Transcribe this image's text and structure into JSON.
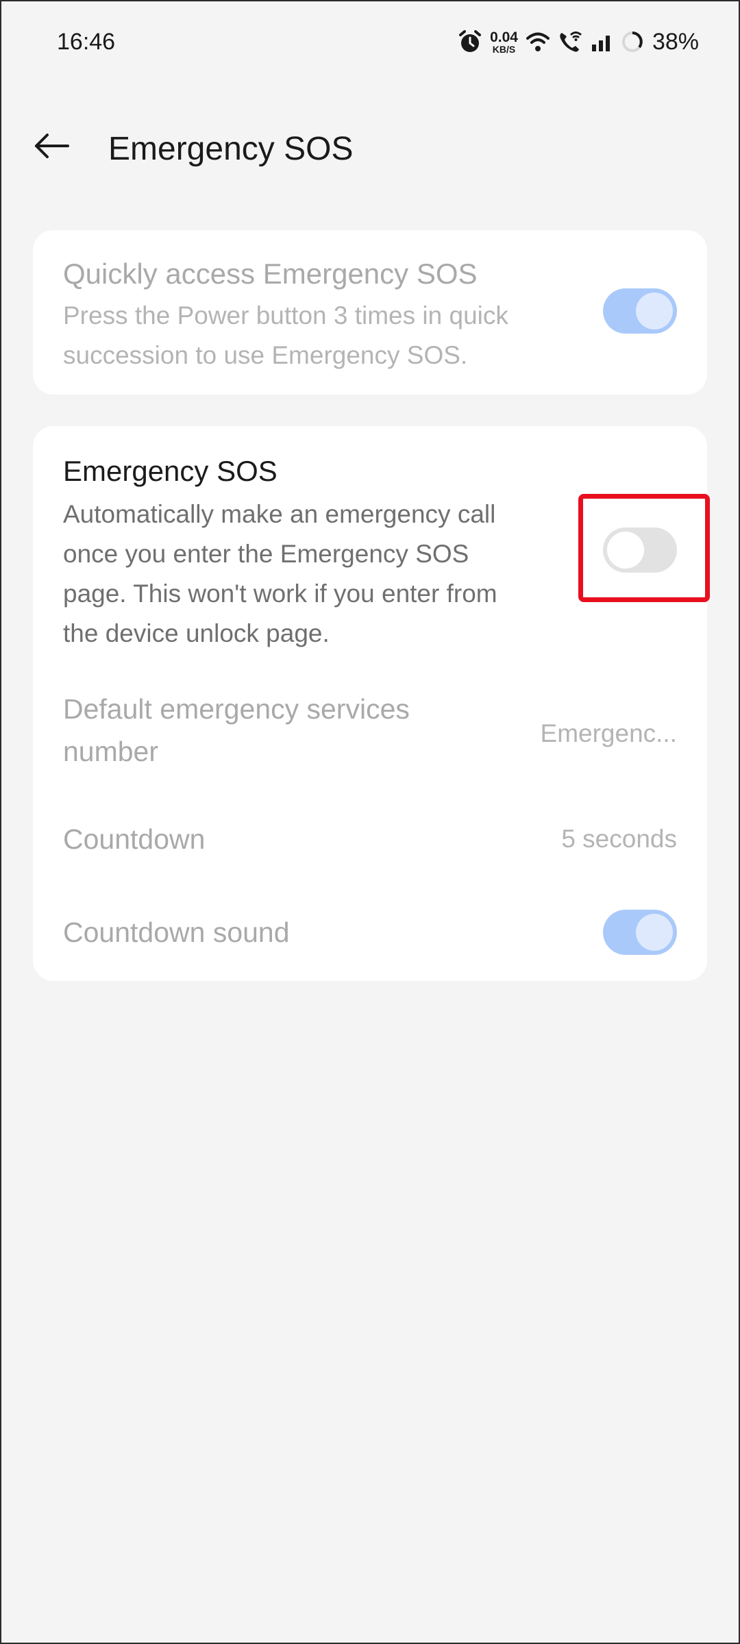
{
  "status_bar": {
    "time": "16:46",
    "net_speed_value": "0.04",
    "net_speed_unit": "KB/S",
    "battery_percent": "38%",
    "icons": [
      "alarm-icon",
      "wifi-icon",
      "wifi-calling-icon",
      "signal-icon",
      "battery-ring-icon"
    ]
  },
  "header": {
    "back_icon": "arrow-left-icon",
    "title": "Emergency SOS"
  },
  "quick_access": {
    "title": "Quickly access Emergency SOS",
    "description_line1": "Press the Power button 3 times in quick",
    "description_line2": "succession to use Emergency SOS.",
    "toggle_state": "on",
    "enabled": false
  },
  "emergency_sos": {
    "title": "Emergency SOS",
    "description_lines": [
      "Automatically make an emergency call",
      "once you enter the Emergency SOS",
      "page. This won't work if you enter from",
      "the device unlock page."
    ],
    "toggle_state": "off",
    "highlighted": true
  },
  "settings": [
    {
      "label_line1": "Default emergency services",
      "label_line2": "number",
      "value": "Emergenc..."
    },
    {
      "label": "Countdown",
      "value": "5 seconds"
    },
    {
      "label": "Countdown sound",
      "toggle_state": "on"
    }
  ],
  "colors": {
    "accent_toggle_on": "#a9c9fb",
    "toggle_off": "#e2e2e3",
    "highlight_red": "#e8101f",
    "background": "#f4f4f5",
    "card": "#ffffff"
  }
}
